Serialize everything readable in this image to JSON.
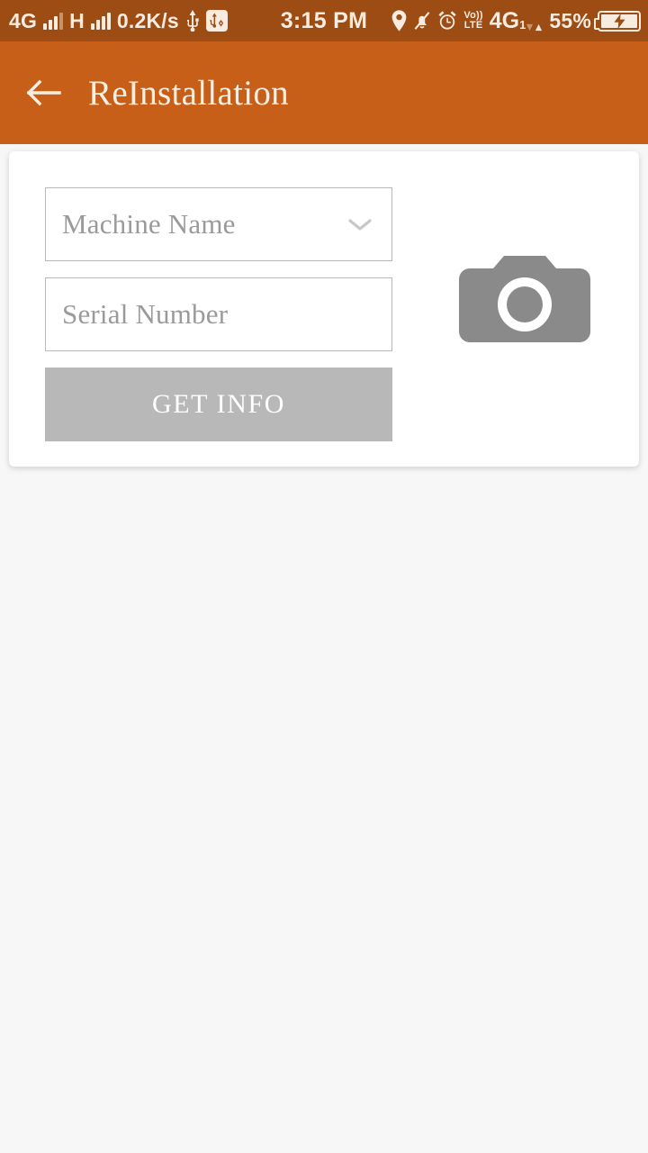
{
  "status_bar": {
    "network_primary": "4G",
    "network_secondary": "H",
    "data_rate": "0.2K/s",
    "clock": "3:15 PM",
    "volte_top": "Vo))",
    "volte_bottom": "LTE",
    "network_right": "4G",
    "sim_index": "1",
    "battery_percent": "55%",
    "icons": {
      "usb": "usb-icon",
      "usb_settings": "usb-settings-icon",
      "location": "location-pin-icon",
      "mute": "bell-muted-icon",
      "alarm": "alarm-clock-icon",
      "battery": "battery-charging-icon"
    },
    "colors": {
      "background": "#9d4c14",
      "foreground": "#f7ecdf"
    }
  },
  "app_bar": {
    "title": "ReInstallation",
    "back_icon": "arrow-left-icon",
    "colors": {
      "background": "#c75f18",
      "foreground": "#f8efe4"
    }
  },
  "form": {
    "machine_name": {
      "placeholder": "Machine Name",
      "value": "",
      "chevron_icon": "chevron-down-icon"
    },
    "serial_number": {
      "placeholder": "Serial Number",
      "value": ""
    },
    "get_info_button": {
      "label": "GET INFO",
      "enabled": false,
      "color": "#b8b8b8",
      "text_color": "#ffffff"
    },
    "camera": {
      "icon": "camera-icon",
      "color": "#8a8a8a"
    }
  },
  "page": {
    "background": "#f7f7f7",
    "card_background": "#ffffff"
  }
}
